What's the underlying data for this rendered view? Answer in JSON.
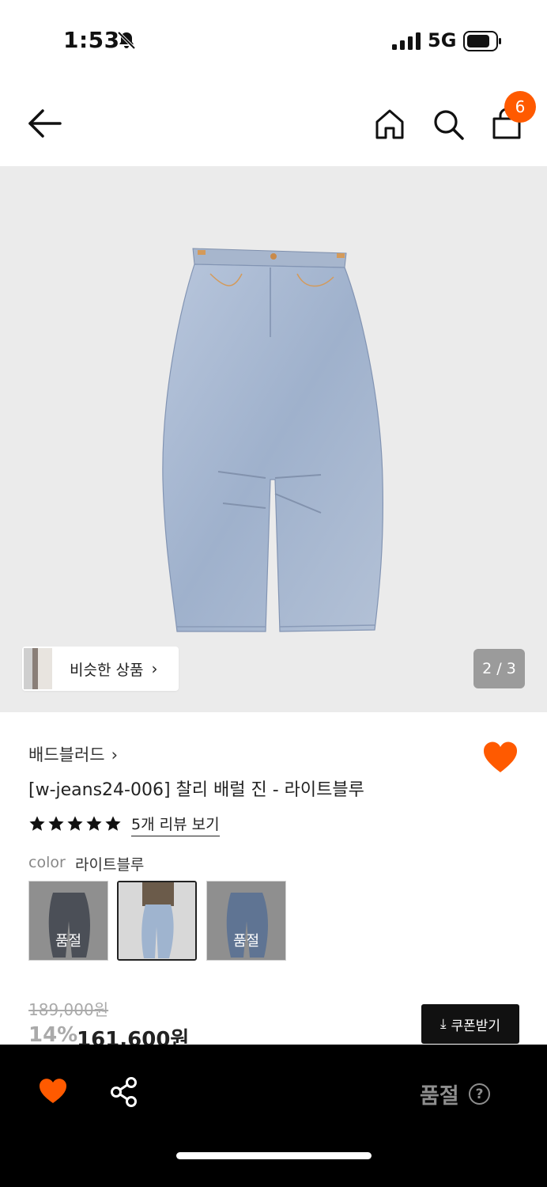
{
  "status_bar": {
    "time": "1:53",
    "network": "5G"
  },
  "nav": {
    "cart_count": "6"
  },
  "gallery": {
    "similar_label": "비슷한 상품",
    "page_indicator": "2 / 3"
  },
  "product": {
    "brand": "배드블러드",
    "title": "[w-jeans24-006] 찰리 배럴 진 - 라이트블루",
    "rating_stars": 5,
    "review_link": "5개 리뷰 보기",
    "color_key": "color",
    "color_value": "라이트블루",
    "swatches": [
      {
        "soldout_label": "품절"
      },
      {
        "soldout_label": ""
      },
      {
        "soldout_label": "품절"
      }
    ],
    "original_price": "189,000원",
    "discount": "14%",
    "sale_price": "161,600원",
    "coupon_label": "쿠폰받기"
  },
  "bottom_bar": {
    "status_label": "품절",
    "help_label": "?"
  },
  "colors": {
    "accent": "#ff5a00",
    "bar": "#000000"
  }
}
